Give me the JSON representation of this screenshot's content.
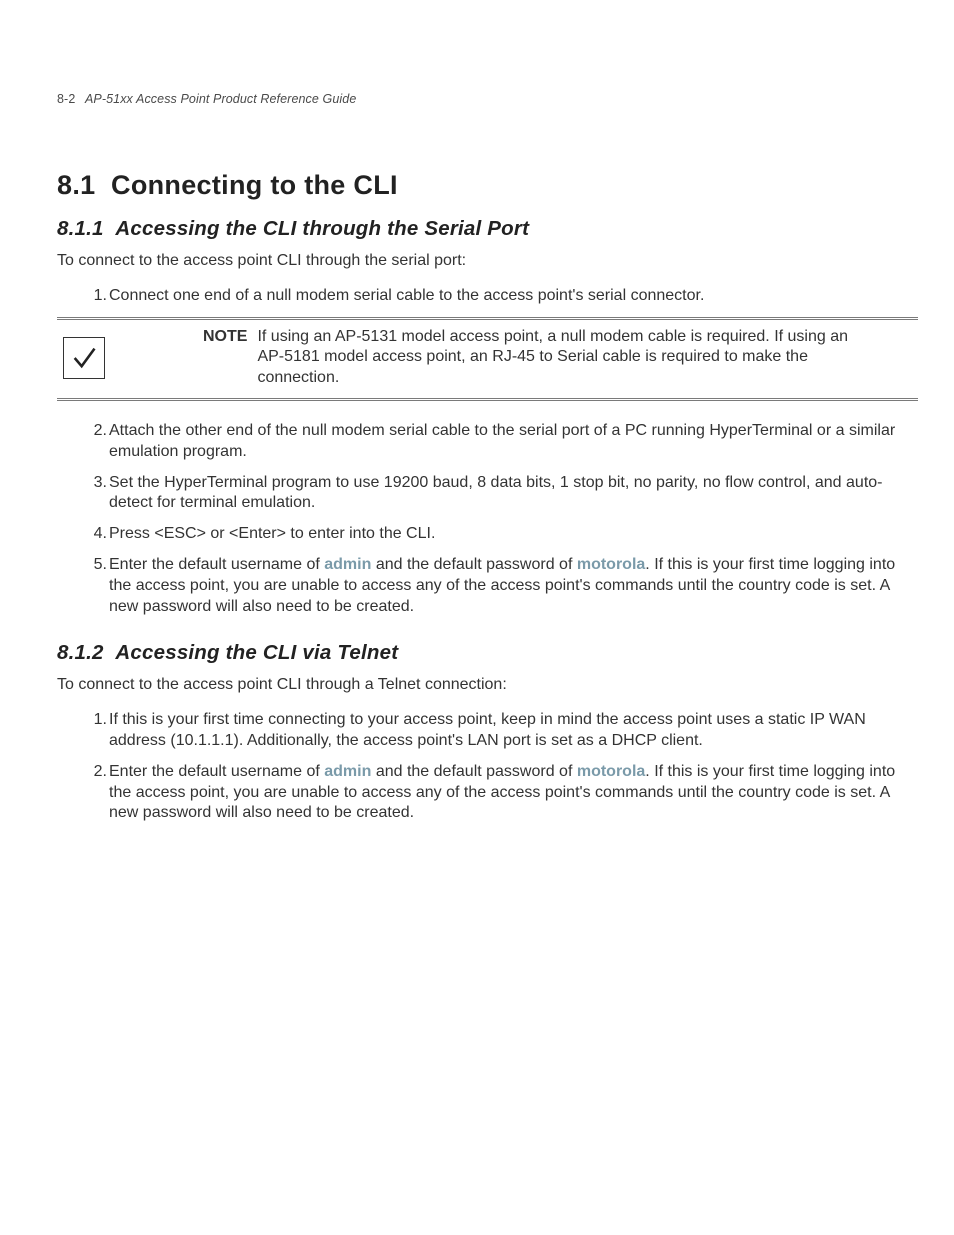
{
  "header": {
    "page_number": "8-2",
    "guide_title": "AP-51xx Access Point Product Reference Guide"
  },
  "section": {
    "number": "8.1",
    "title": "Connecting to the CLI"
  },
  "sub1": {
    "number": "8.1.1",
    "title": "Accessing the CLI through the Serial Port",
    "intro": "To connect to the access point CLI through the serial port:",
    "step1": "Connect one end of a null modem serial cable to the access point's serial connector.",
    "note_label": "NOTE",
    "note_body": "If using an AP-5131 model access point, a null modem cable is required. If using an AP-5181 model access point, an RJ-45 to Serial cable is required to make the connection.",
    "step2": "Attach the other end of the null modem serial cable to the serial port of a PC running HyperTerminal or a similar emulation program.",
    "step3": "Set the HyperTerminal program to use 19200 baud, 8 data bits, 1 stop bit, no parity, no flow control, and auto-detect for terminal emulation.",
    "step4": "Press <ESC> or <Enter> to enter into the CLI.",
    "step5_pre": "Enter the default username of ",
    "step5_user": "admin",
    "step5_mid": " and the default password of ",
    "step5_pass": "motorola",
    "step5_post": ". If this is your first time logging into the access point, you are unable to access any of the access point's commands until the country code is set. A new password will also need to be created."
  },
  "sub2": {
    "number": "8.1.2",
    "title": "Accessing the CLI via Telnet",
    "intro": "To connect to the access point CLI through a Telnet connection:",
    "step1": "If this is your first time connecting to your access point, keep in mind the access point uses a static IP WAN address (10.1.1.1). Additionally, the access point's LAN port is set as a DHCP client.",
    "step2_pre": "Enter the default username of ",
    "step2_user": "admin",
    "step2_mid": " and the default password of ",
    "step2_pass": "motorola",
    "step2_post": ". If this is your first time logging into the access point, you are unable to access any of the access point's commands until the country code is set. A new password will also need to be created."
  }
}
